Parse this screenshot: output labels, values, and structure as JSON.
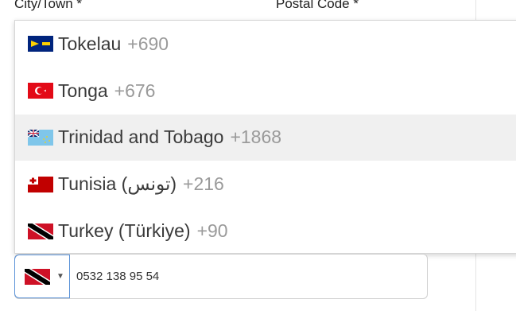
{
  "form": {
    "city_label": "City/Town *",
    "postal_label": "Postal Code *"
  },
  "dropdown": {
    "items": [
      {
        "name": "Tokelau",
        "dial": "+690",
        "flag": "tokelau-flag-icon",
        "highlighted": false
      },
      {
        "name": "Tonga",
        "dial": "+676",
        "flag": "tonga-flag-icon",
        "highlighted": false
      },
      {
        "name": "Trinidad and Tobago",
        "dial": "+1868",
        "flag": "tuvalu-flag-icon",
        "highlighted": true
      },
      {
        "name": "Tunisia (تونس)",
        "dial": "+216",
        "flag": "tonga-flag-icon",
        "highlighted": false
      },
      {
        "name": "Turkey (Türkiye)",
        "dial": "+90",
        "flag": "trinidad-flag-icon",
        "highlighted": false
      }
    ]
  },
  "phone": {
    "selected_flag": "trinidad-flag-icon",
    "value": "0532 138 95 54"
  },
  "colors": {
    "focus_border": "#5b93d8",
    "highlight_row": "#f0f0f0",
    "dial_code": "#9a9a9a"
  }
}
